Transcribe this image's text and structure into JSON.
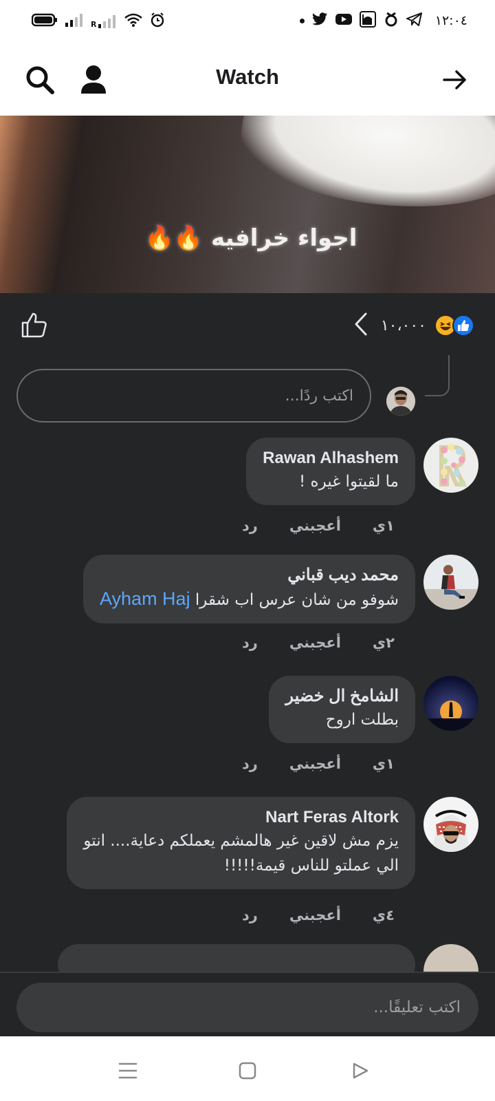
{
  "status_bar": {
    "time": "١٢:٠٤",
    "icons": [
      "battery-icon",
      "signal-icon",
      "roaming-signal-icon",
      "wifi-icon",
      "alarm-icon",
      "dot-icon",
      "twitter-icon",
      "youtube-icon",
      "mosque-app-icon",
      "app-icon",
      "telegram-icon"
    ],
    "roaming_label": "R"
  },
  "header": {
    "title": "Watch",
    "icons": [
      "search-icon",
      "profile-icon",
      "forward-arrow-icon"
    ]
  },
  "video": {
    "caption": "اجواء خرافيه 🔥🔥"
  },
  "reactions": {
    "count": "١٠،٠٠٠",
    "types": [
      "like-icon",
      "haha-icon"
    ],
    "colors": {
      "like": "#1877f2",
      "haha": "#f7b125"
    }
  },
  "reply": {
    "placeholder": "اكتب ردًا..."
  },
  "comments": [
    {
      "author": "Rawan Alhashem",
      "text": "ما لقيتوا غيره !",
      "time": "١ي",
      "like_label": "أعجبني",
      "reply_label": "رد",
      "avatar": "floral-letter-avatar"
    },
    {
      "author": "محمد ديب قباني",
      "text": "شوفو من شان عرس اب شقرا",
      "mention": "Ayham Haj",
      "time": "٢ي",
      "like_label": "أعجبني",
      "reply_label": "رد",
      "avatar": "man-sitting-avatar"
    },
    {
      "author": "الشامخ ال خضير",
      "text": "بطلت اروح",
      "time": "١ي",
      "like_label": "أعجبني",
      "reply_label": "رد",
      "avatar": "moon-silhouette-avatar"
    },
    {
      "author": "Nart Feras Altork",
      "text_line1": "يزم مش لاقين غير هالمشم يعملكم دعاية.... انتو",
      "text_line2": "الي عملتو للناس قيمة!!!!!",
      "time": "٤ي",
      "like_label": "أعجبني",
      "reply_label": "رد",
      "avatar": "keffiyeh-avatar"
    }
  ],
  "comment_bar": {
    "placeholder": "اكتب تعليقًا..."
  },
  "nav_bar": {
    "icons": [
      "recents-icon",
      "home-icon",
      "back-icon"
    ]
  },
  "colors": {
    "dark_bg": "#242526",
    "bubble": "#3a3b3c",
    "mention": "#5aa7ff",
    "secondary_text": "#b0b3b8"
  }
}
